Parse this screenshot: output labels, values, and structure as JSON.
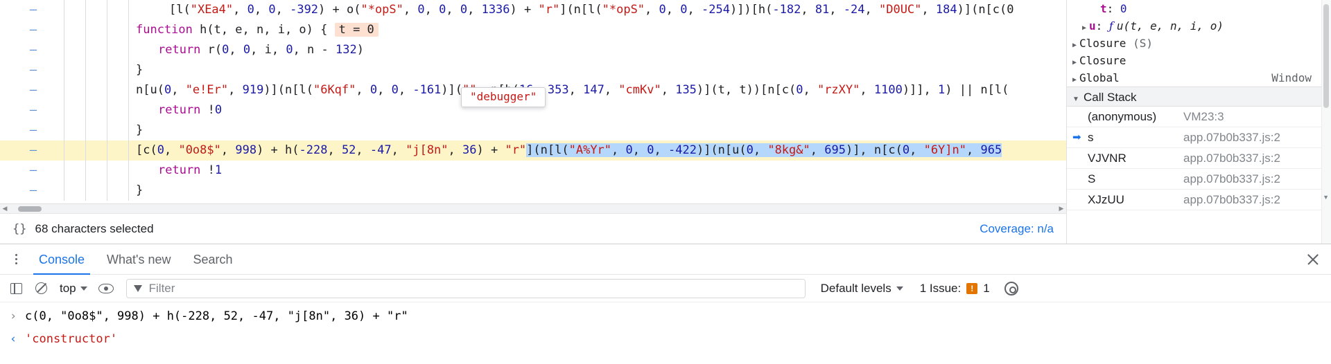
{
  "editor": {
    "lines": [
      {
        "id": "line-1",
        "indent": 48,
        "segments": [
          {
            "t": "[l(",
            "c": "plain"
          },
          {
            "t": "\"XEa4\"",
            "c": "str"
          },
          {
            "t": ", ",
            "c": "plain"
          },
          {
            "t": "0",
            "c": "num"
          },
          {
            "t": ", ",
            "c": "plain"
          },
          {
            "t": "0",
            "c": "num"
          },
          {
            "t": ", ",
            "c": "plain"
          },
          {
            "t": "-392",
            "c": "num"
          },
          {
            "t": ") + o(",
            "c": "plain"
          },
          {
            "t": "\"*opS\"",
            "c": "str"
          },
          {
            "t": ", ",
            "c": "plain"
          },
          {
            "t": "0",
            "c": "num"
          },
          {
            "t": ", ",
            "c": "plain"
          },
          {
            "t": "0",
            "c": "num"
          },
          {
            "t": ", ",
            "c": "plain"
          },
          {
            "t": "0",
            "c": "num"
          },
          {
            "t": ", ",
            "c": "plain"
          },
          {
            "t": "1336",
            "c": "num"
          },
          {
            "t": ") + ",
            "c": "plain"
          },
          {
            "t": "\"r\"",
            "c": "str"
          },
          {
            "t": "](n[l(",
            "c": "plain"
          },
          {
            "t": "\"*opS\"",
            "c": "str"
          },
          {
            "t": ", ",
            "c": "plain"
          },
          {
            "t": "0",
            "c": "num"
          },
          {
            "t": ", ",
            "c": "plain"
          },
          {
            "t": "0",
            "c": "num"
          },
          {
            "t": ", ",
            "c": "plain"
          },
          {
            "t": "-254",
            "c": "num"
          },
          {
            "t": ")])[h(",
            "c": "plain"
          },
          {
            "t": "-182",
            "c": "num"
          },
          {
            "t": ", ",
            "c": "plain"
          },
          {
            "t": "81",
            "c": "num"
          },
          {
            "t": ", ",
            "c": "plain"
          },
          {
            "t": "-24",
            "c": "num"
          },
          {
            "t": ", ",
            "c": "plain"
          },
          {
            "t": "\"D0UC\"",
            "c": "str"
          },
          {
            "t": ", ",
            "c": "plain"
          },
          {
            "t": "184",
            "c": "num"
          },
          {
            "t": ")](n[c(0",
            "c": "plain"
          }
        ]
      },
      {
        "id": "line-2",
        "indent": 0,
        "segments": [
          {
            "t": "function",
            "c": "kw"
          },
          {
            "t": " h(t, e, n, i, o) { ",
            "c": "plain"
          },
          {
            "t": "t = 0",
            "c": "inline-value"
          }
        ]
      },
      {
        "id": "line-3",
        "indent": 32,
        "segments": [
          {
            "t": "return",
            "c": "kw"
          },
          {
            "t": " r(",
            "c": "plain"
          },
          {
            "t": "0",
            "c": "num"
          },
          {
            "t": ", ",
            "c": "plain"
          },
          {
            "t": "0",
            "c": "num"
          },
          {
            "t": ", i, ",
            "c": "plain"
          },
          {
            "t": "0",
            "c": "num"
          },
          {
            "t": ", n - ",
            "c": "plain"
          },
          {
            "t": "132",
            "c": "num"
          },
          {
            "t": ")",
            "c": "plain"
          }
        ]
      },
      {
        "id": "line-4",
        "indent": 0,
        "segments": [
          {
            "t": "}",
            "c": "plain"
          }
        ]
      },
      {
        "id": "line-5",
        "indent": 0,
        "segments": [
          {
            "t": "n[u(",
            "c": "plain"
          },
          {
            "t": "0",
            "c": "num"
          },
          {
            "t": ", ",
            "c": "plain"
          },
          {
            "t": "\"e!Er\"",
            "c": "str"
          },
          {
            "t": ", ",
            "c": "plain"
          },
          {
            "t": "919",
            "c": "num"
          },
          {
            "t": ")](n[l(",
            "c": "plain"
          },
          {
            "t": "\"6Kqf\"",
            "c": "str"
          },
          {
            "t": ", ",
            "c": "plain"
          },
          {
            "t": "0",
            "c": "num"
          },
          {
            "t": ", ",
            "c": "plain"
          },
          {
            "t": "0",
            "c": "num"
          },
          {
            "t": ", ",
            "c": "plain"
          },
          {
            "t": "-161",
            "c": "num"
          },
          {
            "t": ")](",
            "c": "plain"
          },
          {
            "t": "\"\"",
            "c": "str"
          },
          {
            "t": ", n[h(",
            "c": "plain"
          },
          {
            "t": "16",
            "c": "num"
          },
          {
            "t": ", ",
            "c": "plain"
          },
          {
            "t": "353",
            "c": "num"
          },
          {
            "t": ", ",
            "c": "plain"
          },
          {
            "t": "147",
            "c": "num"
          },
          {
            "t": ", ",
            "c": "plain"
          },
          {
            "t": "\"cmKv\"",
            "c": "str"
          },
          {
            "t": ", ",
            "c": "plain"
          },
          {
            "t": "135",
            "c": "num"
          },
          {
            "t": ")](t, t))[n[c(",
            "c": "plain"
          },
          {
            "t": "0",
            "c": "num"
          },
          {
            "t": ", ",
            "c": "plain"
          },
          {
            "t": "\"rzXY\"",
            "c": "str"
          },
          {
            "t": ", ",
            "c": "plain"
          },
          {
            "t": "1100",
            "c": "num"
          },
          {
            "t": ")]], ",
            "c": "plain"
          },
          {
            "t": "1",
            "c": "num"
          },
          {
            "t": ") || n[l(",
            "c": "plain"
          }
        ]
      },
      {
        "id": "line-6",
        "indent": 32,
        "segments": [
          {
            "t": "return",
            "c": "kw"
          },
          {
            "t": " !",
            "c": "plain"
          },
          {
            "t": "0",
            "c": "num"
          }
        ]
      },
      {
        "id": "line-7",
        "indent": 0,
        "segments": [
          {
            "t": "}",
            "c": "plain"
          }
        ]
      },
      {
        "id": "line-8",
        "indent": 0,
        "highlighted": true,
        "segments": [
          {
            "t": "[c(",
            "c": "plain"
          },
          {
            "t": "0",
            "c": "num"
          },
          {
            "t": ", ",
            "c": "plain"
          },
          {
            "t": "\"0o8$\"",
            "c": "str"
          },
          {
            "t": ", ",
            "c": "plain"
          },
          {
            "t": "998",
            "c": "num"
          },
          {
            "t": ") + h(",
            "c": "plain"
          },
          {
            "t": "-228",
            "c": "num"
          },
          {
            "t": ", ",
            "c": "plain"
          },
          {
            "t": "52",
            "c": "num"
          },
          {
            "t": ", ",
            "c": "plain"
          },
          {
            "t": "-47",
            "c": "num"
          },
          {
            "t": ", ",
            "c": "plain"
          },
          {
            "t": "\"j[8n\"",
            "c": "str"
          },
          {
            "t": ", ",
            "c": "plain"
          },
          {
            "t": "36",
            "c": "num"
          },
          {
            "t": ") + ",
            "c": "plain"
          },
          {
            "t": "\"r\"",
            "c": "str"
          },
          {
            "t": "](",
            "c": "plain",
            "selected": true
          },
          {
            "t": "n[l(",
            "c": "plain",
            "selected": true
          },
          {
            "t": "\"A%Yr\"",
            "c": "str",
            "selected": true
          },
          {
            "t": ", ",
            "c": "plain",
            "selected": true
          },
          {
            "t": "0",
            "c": "num",
            "selected": true
          },
          {
            "t": ", ",
            "c": "plain",
            "selected": true
          },
          {
            "t": "0",
            "c": "num",
            "selected": true
          },
          {
            "t": ", ",
            "c": "plain",
            "selected": true
          },
          {
            "t": "-422",
            "c": "num",
            "selected": true
          },
          {
            "t": ")](n[u(",
            "c": "plain",
            "selected": true
          },
          {
            "t": "0",
            "c": "num",
            "selected": true
          },
          {
            "t": ", ",
            "c": "plain",
            "selected": true
          },
          {
            "t": "\"8kg&\"",
            "c": "str",
            "selected": true
          },
          {
            "t": ", ",
            "c": "plain",
            "selected": true
          },
          {
            "t": "695",
            "c": "num",
            "selected": true
          },
          {
            "t": ")], n[c(",
            "c": "plain",
            "selected": true
          },
          {
            "t": "0",
            "c": "num",
            "selected": true
          },
          {
            "t": ", ",
            "c": "plain",
            "selected": true
          },
          {
            "t": "\"6Y]n\"",
            "c": "str",
            "selected": true
          },
          {
            "t": ", ",
            "c": "plain",
            "selected": true
          },
          {
            "t": "965",
            "c": "num",
            "selected": true
          }
        ]
      },
      {
        "id": "line-9",
        "indent": 32,
        "segments": [
          {
            "t": "return",
            "c": "kw"
          },
          {
            "t": " !",
            "c": "plain"
          },
          {
            "t": "1",
            "c": "num"
          }
        ]
      },
      {
        "id": "line-10",
        "indent": 0,
        "segments": [
          {
            "t": "}",
            "c": "plain"
          }
        ]
      }
    ],
    "gutter_marker": "–",
    "tooltip": "\"debugger\"",
    "status": {
      "icon": "{}",
      "text": "68 characters selected",
      "coverage": "Coverage: n/a"
    }
  },
  "sidebar": {
    "scope_rows": [
      {
        "name": "t",
        "separator": ":",
        "value": "0",
        "value_kind": "num",
        "expandable": false,
        "indent": 34
      },
      {
        "name": "u",
        "separator": ":",
        "value": "u(t, e, n, i, o)",
        "value_kind": "function",
        "fn_glyph": "ƒ",
        "expandable": true,
        "indent": 18
      },
      {
        "label": "Closure",
        "sub": "(S)",
        "expandable": true,
        "indent": 4
      },
      {
        "label": "Closure",
        "sub": "",
        "expandable": true,
        "indent": 4
      },
      {
        "label": "Global",
        "sub": "",
        "right": "Window",
        "expandable": true,
        "indent": 4
      }
    ],
    "call_stack": {
      "title": "Call Stack",
      "expanded_glyph": "▼",
      "frames": [
        {
          "name": "(anonymous)",
          "location": "VM23:3",
          "current": false
        },
        {
          "name": "s",
          "location": "app.07b0b337.js:2",
          "current": true
        },
        {
          "name": "VJVNR",
          "location": "app.07b0b337.js:2",
          "current": false
        },
        {
          "name": "S",
          "location": "app.07b0b337.js:2",
          "current": false
        },
        {
          "name": "XJzUU",
          "location": "app.07b0b337.js:2",
          "current": false
        }
      ]
    }
  },
  "drawer": {
    "tabs": [
      {
        "label": "Console",
        "active": true
      },
      {
        "label": "What's new",
        "active": false
      },
      {
        "label": "Search",
        "active": false
      }
    ],
    "toolbar": {
      "context": "top",
      "filter_placeholder": "Filter",
      "filter_value": "",
      "levels": "Default levels",
      "issues_text": "1 Issue:",
      "issues_count": "1"
    },
    "messages": [
      {
        "type": "input",
        "prompt": "›",
        "text": "c(0, \"0o8$\", 998) + h(-228, 52, -47, \"j[8n\", 36) + \"r\""
      },
      {
        "type": "output",
        "prompt": "‹",
        "text": "'constructor'"
      }
    ]
  }
}
